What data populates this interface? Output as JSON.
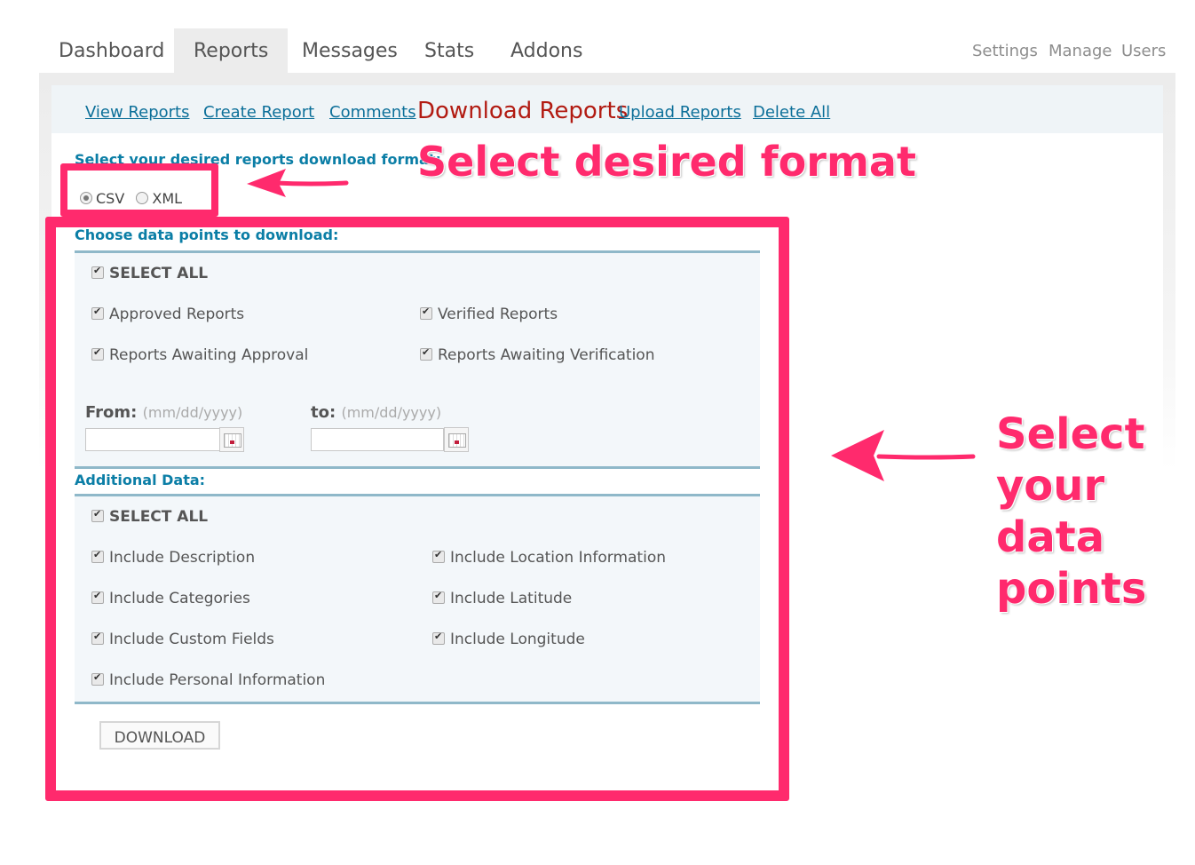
{
  "top_nav": {
    "tabs": [
      {
        "label": "Dashboard"
      },
      {
        "label": "Reports"
      },
      {
        "label": "Messages"
      },
      {
        "label": "Stats"
      },
      {
        "label": "Addons"
      }
    ],
    "active_tab": "Reports",
    "right_links": [
      "Settings",
      "Manage",
      "Users"
    ]
  },
  "sub_nav": {
    "links": [
      "View Reports",
      "Create Report",
      "Comments",
      "Download Reports",
      "Upload Reports",
      "Delete All"
    ],
    "current": "Download Reports"
  },
  "format": {
    "label": "Select your desired reports download format:",
    "options": [
      {
        "label": "CSV",
        "selected": true
      },
      {
        "label": "XML",
        "selected": false
      }
    ]
  },
  "data_points": {
    "heading": "Choose data points to download:",
    "select_all": "SELECT ALL",
    "items": [
      {
        "label": "Approved Reports",
        "checked": true
      },
      {
        "label": "Verified Reports",
        "checked": true
      },
      {
        "label": "Reports Awaiting Approval",
        "checked": true
      },
      {
        "label": "Reports Awaiting Verification",
        "checked": true
      }
    ],
    "from_label": "From:",
    "from_hint": "(mm/dd/yyyy)",
    "to_label": "to:",
    "to_hint": "(mm/dd/yyyy)",
    "from_value": "",
    "to_value": ""
  },
  "additional": {
    "heading": "Additional Data:",
    "select_all": "SELECT ALL",
    "items": [
      {
        "label": "Include Description",
        "checked": true
      },
      {
        "label": "Include Location Information",
        "checked": true
      },
      {
        "label": "Include Categories",
        "checked": true
      },
      {
        "label": "Include Latitude",
        "checked": true
      },
      {
        "label": "Include Custom Fields",
        "checked": true
      },
      {
        "label": "Include Longitude",
        "checked": true
      },
      {
        "label": "Include Personal Information",
        "checked": true
      }
    ]
  },
  "download_button": "DOWNLOAD",
  "annotations": {
    "format_callout": "Select desired format",
    "points_callout": [
      "Select",
      "your",
      "data",
      "points"
    ],
    "color": "#ff2a6d"
  }
}
